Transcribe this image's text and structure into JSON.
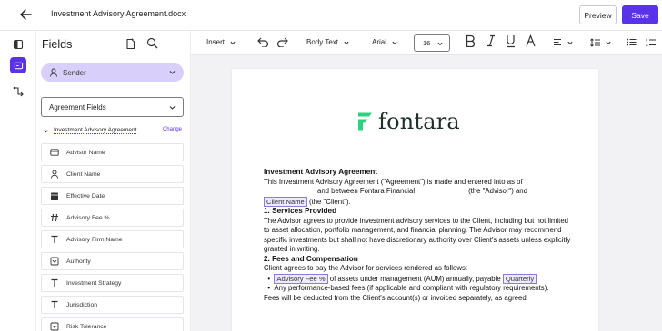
{
  "header": {
    "doc_title": "Investment Advisory Agreement.docx",
    "preview_label": "Preview",
    "save_label": "Save"
  },
  "colors": {
    "accent": "#5a32e8",
    "sender_bg": "#d8d0fa",
    "chip_border": "#8a7ae6",
    "logo_green": "#2fd17e"
  },
  "panel": {
    "title": "Fields",
    "sender_label": "Sender",
    "agreement_select": "Agreement Fields",
    "group_label": "Investment Advisory Agreement",
    "change_label": "Change",
    "fields": [
      {
        "label": "Advisor Name",
        "icon": "id-card-icon"
      },
      {
        "label": "Client Name",
        "icon": "person-icon"
      },
      {
        "label": "Effective Date",
        "icon": "calendar-icon"
      },
      {
        "label": "Advisory Fee %",
        "icon": "hash-icon"
      },
      {
        "label": "Advisory Firm Name",
        "icon": "text-icon"
      },
      {
        "label": "Authority",
        "icon": "dropdown-icon"
      },
      {
        "label": "Investment Strategy",
        "icon": "text-icon"
      },
      {
        "label": "Jurisdiction",
        "icon": "text-icon"
      },
      {
        "label": "Risk Tolerance",
        "icon": "dropdown-icon"
      }
    ]
  },
  "toolbar": {
    "insert_label": "Insert",
    "style_label": "Body Text",
    "font_label": "Arial",
    "size_label": "16"
  },
  "document": {
    "logo_text": "fontara",
    "title": "Investment Advisory Agreement",
    "intro_1": "This Investment Advisory Agreement (\"Agreement\") is made and entered into as of",
    "intro_2": "and between Fontara Financial",
    "intro_3": "(the \"Advisor\") and",
    "client_chip": "Client Name",
    "intro_4": "(the \"Client\").",
    "s1_heading": "1. Services Provided",
    "s1_text": "The Advisor agrees to provide investment advisory services to the Client, including but not limited to asset allocation, portfolio management, and financial planning. The Advisor may recommend specific investments but shall not have discretionary authority over Client's assets unless explicitly granted in writing.",
    "s2_heading": "2. Fees and Compensation",
    "s2_intro": "Client agrees to pay the Advisor for services rendered as follows:",
    "fee_chip": "Advisory Fee %",
    "fee_text": "of assets under management (AUM) annually, payable",
    "quarterly_chip": "Quarterly",
    "bullet_2": "Any performance-based fees (if applicable and compliant with regulatory requirements).",
    "s2_closing": "Fees will be deducted from the Client's account(s) or invoiced separately, as agreed."
  }
}
